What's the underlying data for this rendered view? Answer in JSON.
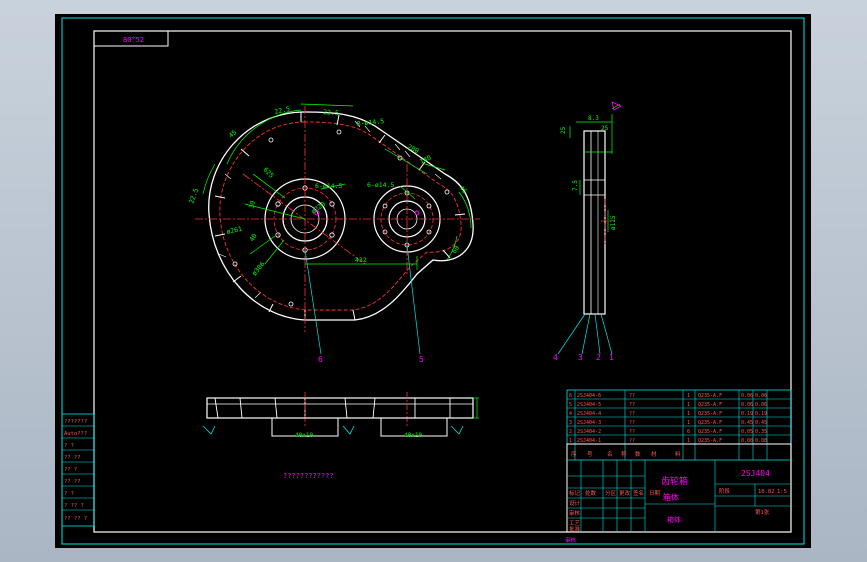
{
  "sheet": {
    "corner_tag": "80°52",
    "note": "????????????",
    "colors": {
      "frame": "#00e6e6",
      "outline": "#ffffff",
      "centerline": "#ff3030",
      "dimension": "#00ff00",
      "leader": "#00e6e6",
      "highlight": "#ff00ff",
      "table_text": "#ff5555"
    }
  },
  "front_view": {
    "dims": {
      "d1": "22.5",
      "d2": "22.5",
      "d3": "8-ø14.5",
      "d4": "45",
      "d5": "625",
      "d6": "22.5",
      "d7": "30",
      "d8": "6-ø14.5",
      "d9": "ø220",
      "d10": "ø261",
      "d11": "ø306",
      "d12": "6-ø14.5",
      "d13": "280",
      "d14": "140",
      "d15": "45",
      "d16": "432",
      "d17": "40",
      "d18": "60"
    },
    "balloons": [
      "6",
      "5"
    ]
  },
  "side_view": {
    "dims": {
      "s1": "25",
      "s2": "8.3",
      "s3": "25",
      "s4": "7.5",
      "s5": "ø115"
    },
    "balloons": [
      "4",
      "3",
      "2",
      "1"
    ]
  },
  "bottom_view": {
    "labels": [
      "40x10",
      "40x10"
    ]
  },
  "parts_list": [
    {
      "no": "6",
      "code": "2SJ404-6",
      "name": "??",
      "qty": "1",
      "material": "Q235-A.F",
      "unit_w": "0.06",
      "total_w": "0.06"
    },
    {
      "no": "5",
      "code": "2SJ404-5",
      "name": "??",
      "qty": "1",
      "material": "Q235-A.F",
      "unit_w": "0.06",
      "total_w": "0.06"
    },
    {
      "no": "4",
      "code": "2SJ404-4",
      "name": "??",
      "qty": "1",
      "material": "Q235-A.F",
      "unit_w": "0.19",
      "total_w": "0.19"
    },
    {
      "no": "3",
      "code": "2SJ404-3",
      "name": "??",
      "qty": "1",
      "material": "Q235-A.F",
      "unit_w": "0.45",
      "total_w": "0.45"
    },
    {
      "no": "2",
      "code": "2SJ404-2",
      "name": "??",
      "qty": "6",
      "material": "Q235-A.F",
      "unit_w": "0.05",
      "total_w": "0.35"
    },
    {
      "no": "1",
      "code": "2SJ404-1",
      "name": "??",
      "qty": "1",
      "material": "Q235-A.F",
      "unit_w": "0.08",
      "total_w": "0.08"
    }
  ],
  "title_block": {
    "drawing_no": "2SJ404",
    "part_title": "齿轮箱",
    "part_subtitle": "箱体",
    "stage": "阶段",
    "weight": "10.82",
    "scale": "1:5",
    "sheet": "第1张",
    "company": "",
    "header_cells": [
      "序",
      "号",
      "名",
      "称",
      "数",
      "材",
      "料"
    ],
    "left_cells": [
      "标记",
      "处数",
      "分区",
      "更改",
      "签名",
      "日期"
    ],
    "rows_labels": [
      "设计",
      "审核",
      "工艺",
      "批准"
    ],
    "bottom_label": "审核"
  },
  "side_column": {
    "cells": [
      "???????",
      "Auto???",
      "?  ?",
      "?? ??",
      "?? ?",
      "?? ??",
      "?  ?",
      "? ?? ?",
      "?? ?? ?"
    ]
  }
}
